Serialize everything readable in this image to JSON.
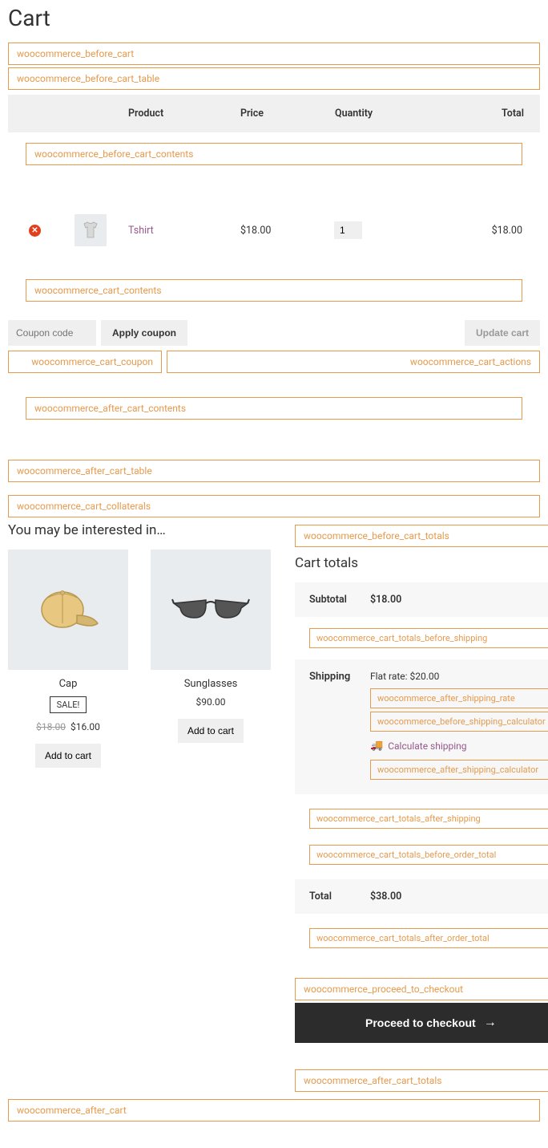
{
  "page_title": "Cart",
  "hooks": {
    "before_cart": "woocommerce_before_cart",
    "before_cart_table": "woocommerce_before_cart_table",
    "before_cart_contents": "woocommerce_before_cart_contents",
    "cart_contents": "woocommerce_cart_contents",
    "cart_coupon": "woocommerce_cart_coupon",
    "cart_actions": "woocommerce_cart_actions",
    "after_cart_contents": "woocommerce_after_cart_contents",
    "after_cart_table": "woocommerce_after_cart_table",
    "cart_collaterals": "woocommerce_cart_collaterals",
    "before_cart_totals": "woocommerce_before_cart_totals",
    "totals_before_shipping": "woocommerce_cart_totals_before_shipping",
    "after_shipping_rate": "woocommerce_after_shipping_rate",
    "before_shipping_calculator": "woocommerce_before_shipping_calculator",
    "after_shipping_calculator": "woocommerce_after_shipping_calculator",
    "totals_after_shipping": "woocommerce_cart_totals_after_shipping",
    "totals_before_order_total": "woocommerce_cart_totals_before_order_total",
    "totals_after_order_total": "woocommerce_cart_totals_after_order_total",
    "proceed_to_checkout": "woocommerce_proceed_to_checkout",
    "after_cart_totals": "woocommerce_after_cart_totals",
    "after_cart": "woocommerce_after_cart"
  },
  "table": {
    "headers": {
      "product": "Product",
      "price": "Price",
      "quantity": "Quantity",
      "total": "Total"
    }
  },
  "cart_item": {
    "name": "Tshirt",
    "price": "$18.00",
    "qty": "1",
    "total": "$18.00"
  },
  "coupon": {
    "placeholder": "Coupon code",
    "apply": "Apply coupon",
    "update": "Update cart"
  },
  "cross_sell": {
    "heading": "You may be interested in…",
    "items": [
      {
        "name": "Cap",
        "sale": "SALE!",
        "old_price": "$18.00",
        "price": "$16.00",
        "button": "Add to cart"
      },
      {
        "name": "Sunglasses",
        "price": "$90.00",
        "button": "Add to cart"
      }
    ]
  },
  "totals": {
    "heading": "Cart totals",
    "subtotal_label": "Subtotal",
    "subtotal": "$18.00",
    "shipping_label": "Shipping",
    "shipping_rate": "Flat rate: $20.00",
    "calc_shipping": "Calculate shipping",
    "total_label": "Total",
    "total": "$38.00",
    "checkout": "Proceed to checkout"
  }
}
